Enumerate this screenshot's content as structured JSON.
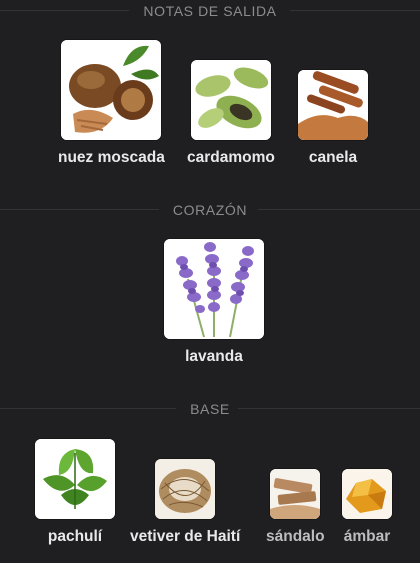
{
  "sections": {
    "top": {
      "title": "NOTAS DE SALIDA",
      "notes": [
        {
          "label": "nuez moscada",
          "icon": "nutmeg-icon"
        },
        {
          "label": "cardamomo",
          "icon": "cardamom-icon"
        },
        {
          "label": "canela",
          "icon": "cinnamon-icon"
        }
      ]
    },
    "heart": {
      "title": "CORAZÓN",
      "notes": [
        {
          "label": "lavanda",
          "icon": "lavender-icon"
        }
      ]
    },
    "base": {
      "title": "BASE",
      "notes": [
        {
          "label": "pachulí",
          "icon": "patchouli-icon"
        },
        {
          "label": "vetiver de Haití",
          "icon": "vetiver-icon"
        },
        {
          "label": "sándalo",
          "icon": "sandalwood-icon"
        },
        {
          "label": "ámbar",
          "icon": "amber-icon"
        }
      ]
    }
  },
  "colors": {
    "background": "#1f1f21",
    "section_title": "#8c8c90",
    "label": "#e9e9ea"
  }
}
